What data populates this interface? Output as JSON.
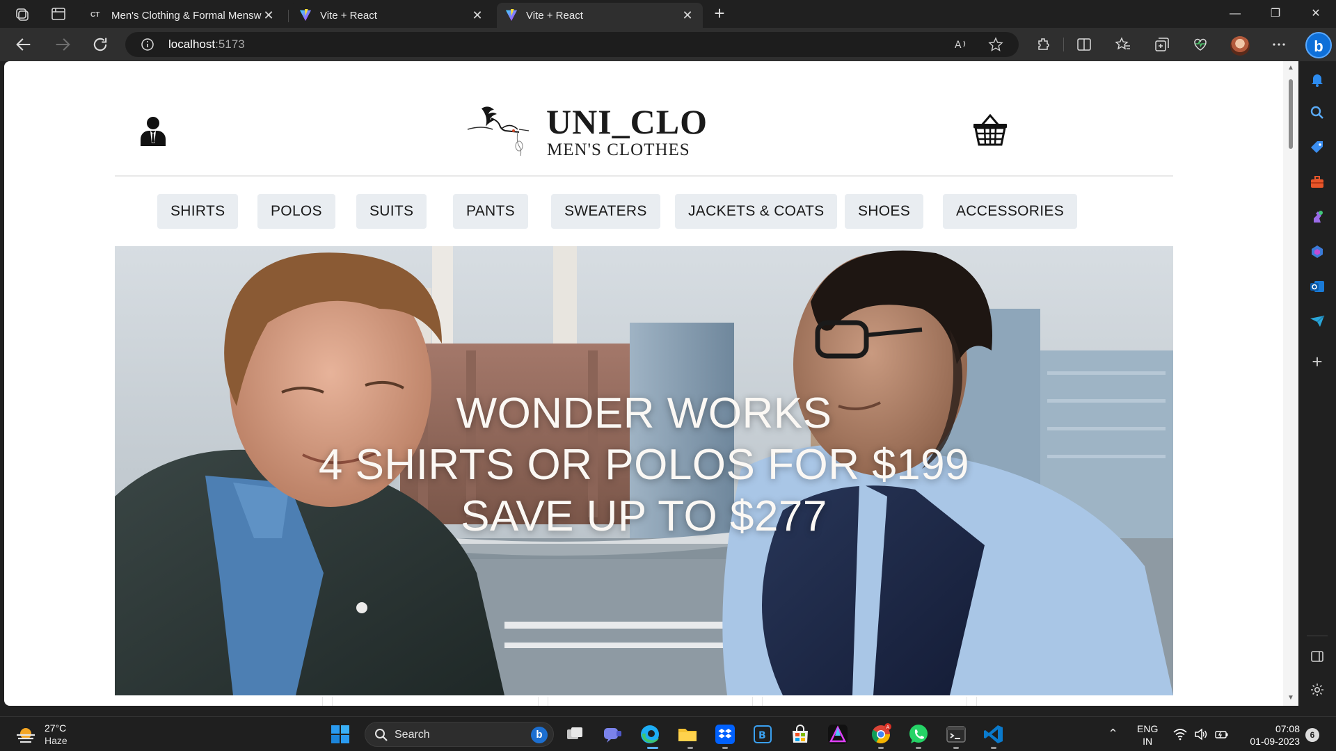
{
  "browser": {
    "tabs": [
      {
        "title": "Men's Clothing & Formal Mensw",
        "favicon": "ct-logo",
        "active": false
      },
      {
        "title": "Vite + React",
        "favicon": "vite-logo",
        "active": false
      },
      {
        "title": "Vite + React",
        "favicon": "vite-logo",
        "active": true
      }
    ],
    "url_host": "localhost",
    "url_port": ":5173"
  },
  "site": {
    "logo_title": "UNI_CLO",
    "logo_subtitle": "MEN'S CLOTHES",
    "categories": [
      "SHIRTS",
      "POLOS",
      "SUITS",
      "PANTS",
      "SWEATERS",
      "JACKETS & COATS",
      "SHOES",
      "ACCESSORIES"
    ],
    "hero": {
      "line1": "WONDER WORKS",
      "line2": "4 SHIRTS OR POLOS FOR $199",
      "line3": "SAVE UP TO $277"
    }
  },
  "taskbar": {
    "weather_temp": "27°C",
    "weather_desc": "Haze",
    "search_placeholder": "Search",
    "lang_line1": "ENG",
    "lang_line2": "IN",
    "time": "07:08",
    "date": "01-09-2023",
    "notification_count": "6"
  },
  "colors": {
    "accent": "#5db3ff",
    "category_bg": "#e9edf1",
    "hero_text": "#fbf8f4"
  }
}
